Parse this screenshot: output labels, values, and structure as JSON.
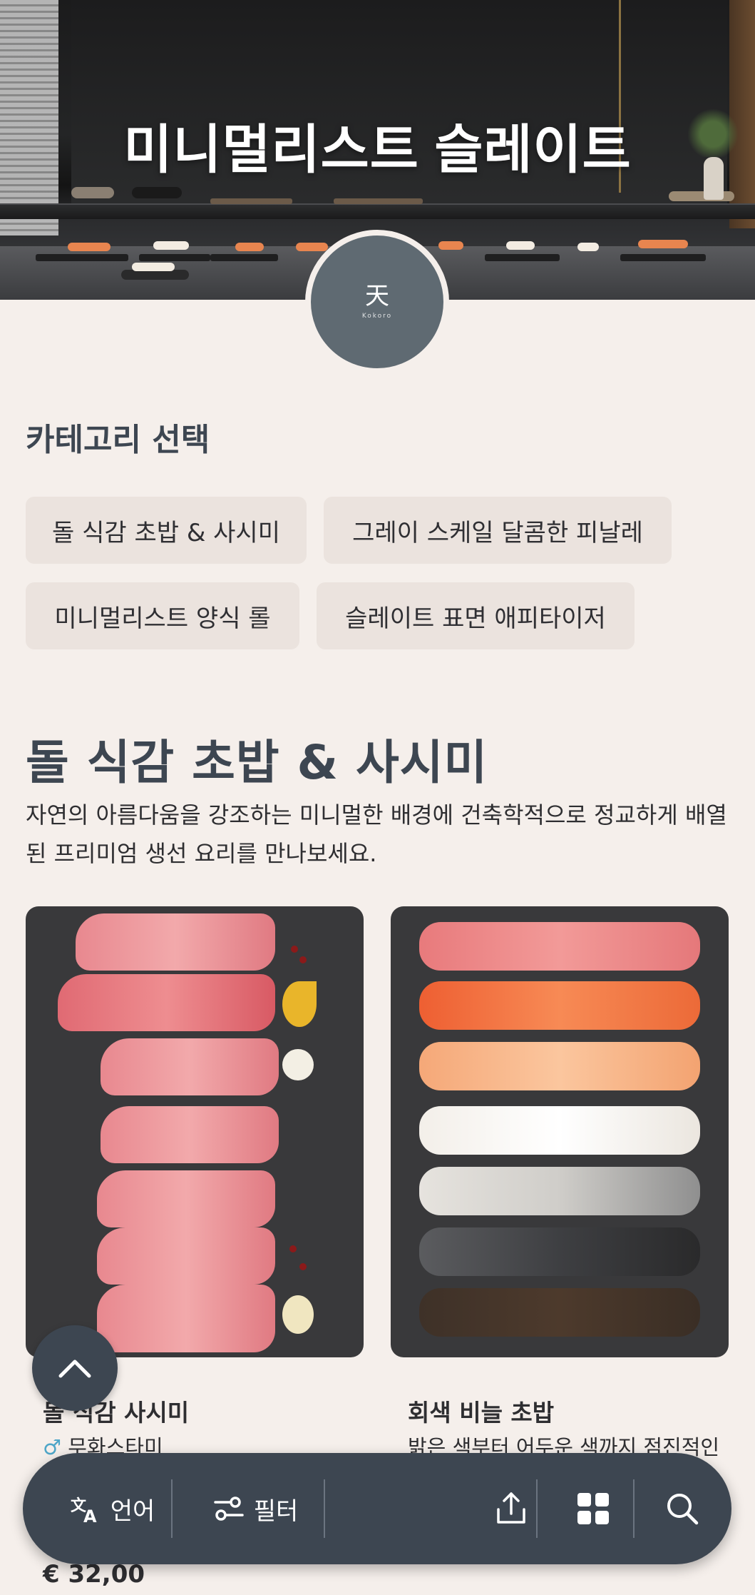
{
  "hero": {
    "title": "미니멀리스트 슬레이트",
    "logo_glyph": "天",
    "logo_sub": "Kokoro"
  },
  "categories": {
    "heading": "카테고리 선택",
    "items": [
      {
        "label": "돌 식감 초밥 & 사시미"
      },
      {
        "label": "그레이 스케일 달콤한 피날레"
      },
      {
        "label": "미니멀리스트 양식 롤"
      },
      {
        "label": "슬레이트 표면 애피타이저"
      }
    ]
  },
  "section": {
    "title": "돌 식감 초밥 & 사시미",
    "description": "자연의 아름다움을 강조하는 미니멀한 배경에 건축학적으로 정교하게 배열된 프리미엄 생선 요리를 만나보세요."
  },
  "products": [
    {
      "name": "돌 식감 사시미",
      "subtitle": "무화스타미",
      "price": "€ 32,00"
    },
    {
      "name": "회색 비늘 초밥",
      "subtitle": "밝은 색부터 어두운 색까지 점진적인"
    }
  ],
  "bottom_bar": {
    "language_label": "언어",
    "filter_label": "필터",
    "icons": [
      "translate-icon",
      "filter-icon",
      "share-icon",
      "grid-icon",
      "search-icon"
    ]
  },
  "colors": {
    "background": "#f5efeb",
    "primary": "#3d4651",
    "chip": "#ebe3de",
    "logo": "#5f6a72"
  }
}
